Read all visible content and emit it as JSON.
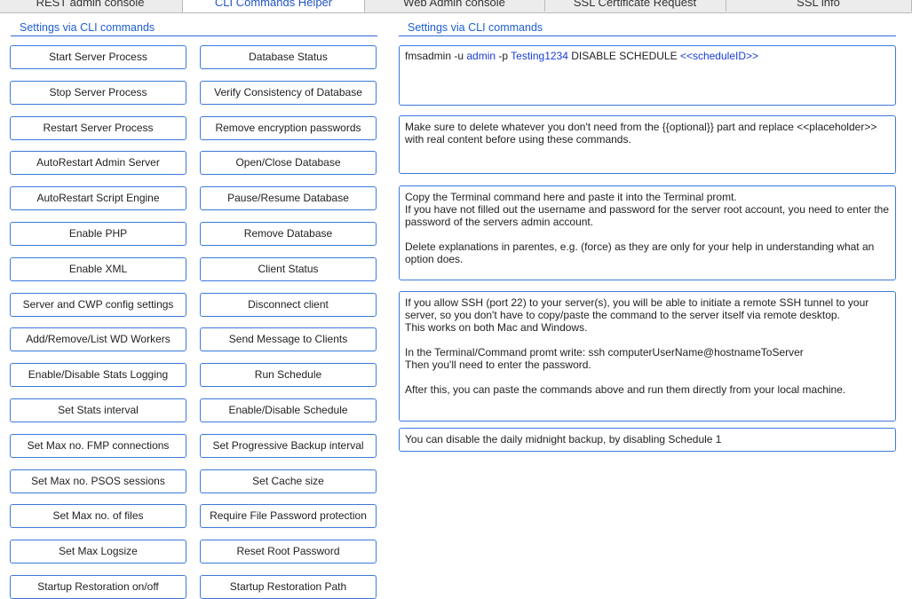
{
  "tabs": [
    {
      "label": "REST admin console",
      "active": false
    },
    {
      "label": "CLI Commands Helper",
      "active": true
    },
    {
      "label": "Web Admin console",
      "active": false
    },
    {
      "label": "SSL Certificate Request",
      "active": false
    },
    {
      "label": "SSL info",
      "active": false
    }
  ],
  "left": {
    "title": "Settings via CLI commands",
    "col1": [
      "Start Server Process",
      "Stop Server Process",
      "Restart Server Process",
      "AutoRestart Admin Server",
      "AutoRestart Script Engine",
      "Enable PHP",
      "Enable XML",
      "Server and CWP config settings",
      "Add/Remove/List WD Workers",
      "Enable/Disable Stats Logging",
      "Set Stats interval",
      "Set Max no. FMP connections",
      "Set Max no. PSOS sessions",
      "Set Max no. of files",
      "Set Max Logsize",
      "Startup Restoration on/off"
    ],
    "col2": [
      "Database Status",
      "Verify Consistency of Database",
      "Remove encryption passwords",
      "Open/Close Database",
      "Pause/Resume Database",
      "Remove Database",
      "Client Status",
      "Disconnect client",
      "Send Message to Clients",
      "Run Schedule",
      "Enable/Disable Schedule",
      "Set Progressive Backup interval",
      "Set Cache size",
      "Require File Password protection",
      "Reset Root Password",
      "Startup Restoration Path"
    ]
  },
  "right": {
    "title": "Settings via CLI commands",
    "command": {
      "p1": "fmsadmin -u ",
      "user": "admin",
      "p2": " -p ",
      "pass": "Testing1234",
      "p3": " DISABLE SCHEDULE ",
      "placeholder": "<<scheduleID>>"
    },
    "note1": [
      "Make sure to delete whatever you don't need from the {{optional}} part and replace <<placeholder>>",
      "with real content before using these commands."
    ],
    "note2": [
      "Copy the Terminal command here and paste it into the Terminal promt.",
      "If you have not filled out the username and password for the server root account, you need to enter the",
      "password of the servers admin account.",
      "",
      "Delete explanations in parentes, e.g. (force) as they are only for your help in understanding what an",
      "option does."
    ],
    "note3": [
      "If you allow SSH (port 22) to your server(s), you will be able to initiate a remote SSH tunnel to your",
      "server, so you don't have to copy/paste the command to the server itself via remote desktop.",
      "This works on both Mac and Windows.",
      "",
      "In the Terminal/Command promt write: ssh computerUserName@hostnameToServer",
      "Then you'll need to enter the password.",
      "",
      "After this, you can paste the commands above and run them directly from your local machine."
    ],
    "note4": "You can disable the daily midnight backup, by disabling Schedule 1"
  }
}
